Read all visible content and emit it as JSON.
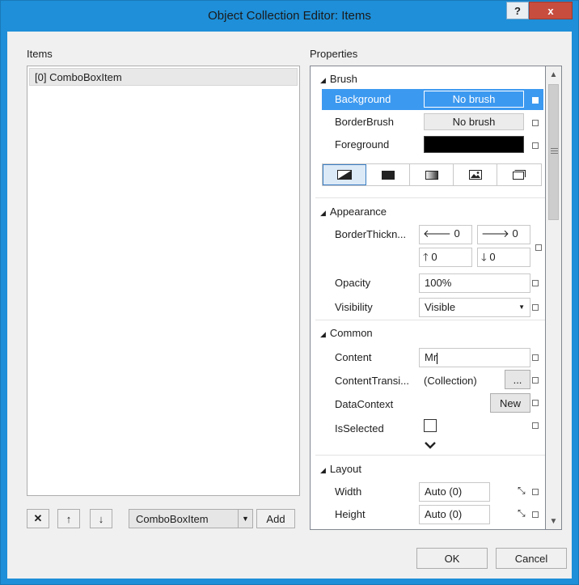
{
  "window": {
    "title": "Object Collection Editor: Items",
    "help_label": "?",
    "close_label": "x"
  },
  "items_panel": {
    "label": "Items",
    "items": [
      "[0] ComboBoxItem"
    ],
    "remove_icon": "✕",
    "up_icon": "↑",
    "down_icon": "↓",
    "type_combo_value": "ComboBoxItem",
    "add_label": "Add"
  },
  "properties": {
    "label": "Properties",
    "brush": {
      "category": "Brush",
      "background_label": "Background",
      "background_value": "No brush",
      "borderbrush_label": "BorderBrush",
      "borderbrush_value": "No brush",
      "foreground_label": "Foreground",
      "foreground_color": "#000000",
      "brush_types": [
        "no-brush-icon",
        "solid-color-icon",
        "gradient-icon",
        "image-brush-icon",
        "resource-icon"
      ]
    },
    "appearance": {
      "category": "Appearance",
      "borderthickness_label": "BorderThickn...",
      "thickness_left": "0",
      "thickness_right": "0",
      "thickness_top": "0",
      "thickness_bottom": "0",
      "opacity_label": "Opacity",
      "opacity_value": "100%",
      "visibility_label": "Visibility",
      "visibility_value": "Visible"
    },
    "common": {
      "category": "Common",
      "content_label": "Content",
      "content_value": "Mr",
      "contenttransitions_label": "ContentTransi...",
      "contenttransitions_value": "(Collection)",
      "ellipsis_label": "...",
      "datacontext_label": "DataContext",
      "new_label": "New",
      "isselected_label": "IsSelected",
      "isselected_checked": false
    },
    "layout": {
      "category": "Layout",
      "width_label": "Width",
      "width_value": "Auto (0)",
      "height_label": "Height",
      "height_value": "Auto (0)"
    }
  },
  "footer": {
    "ok_label": "OK",
    "cancel_label": "Cancel"
  },
  "colors": {
    "title_bar": "#1e8fd8",
    "selection": "#3c99f0",
    "close_button": "#c74d3f"
  }
}
